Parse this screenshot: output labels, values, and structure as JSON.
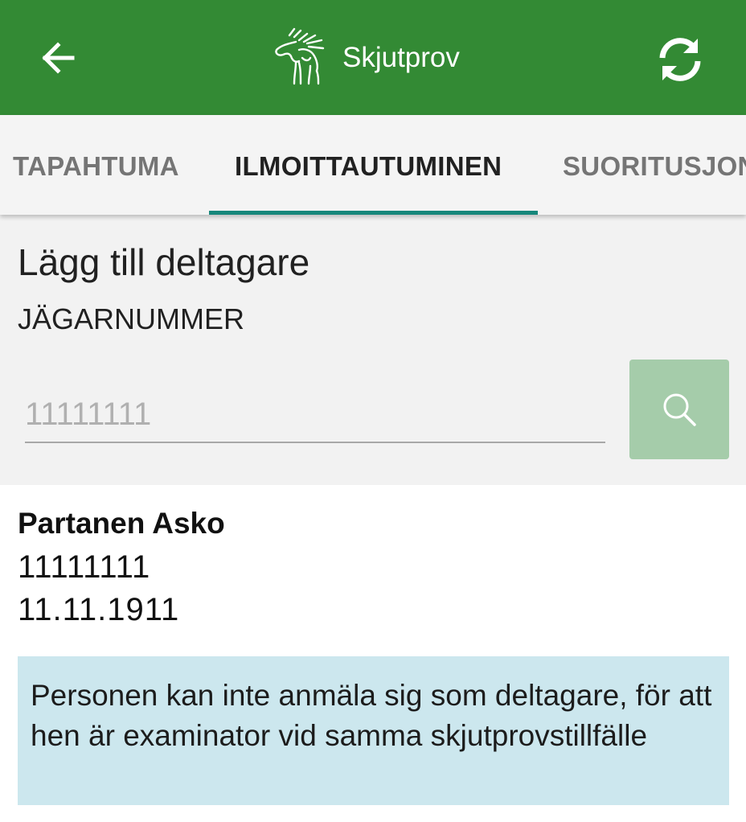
{
  "app_bar": {
    "title": "Skjutprov",
    "back_icon": "arrow-left-icon",
    "refresh_icon": "sync-icon",
    "logo_icon": "moose-logo-icon",
    "background_color": "#338a34"
  },
  "tabs": [
    {
      "label": "TAPAHTUMA",
      "active": false
    },
    {
      "label": "ILMOITTAUTUMINEN",
      "active": true
    },
    {
      "label": "SUORITUSJONO",
      "active": false
    }
  ],
  "tab_indicator_color": "#17877b",
  "form": {
    "title": "Lägg till deltagare",
    "field_label": "JÄGARNUMMER",
    "hunter_number_placeholder": "11111111",
    "hunter_number_value": "",
    "search_icon": "search-icon",
    "search_button_color": "#a5ccaa"
  },
  "result": {
    "name": "Partanen Asko",
    "hunter_number": "11111111",
    "birth_date": "11.11.1911"
  },
  "notice": {
    "text": "Personen kan inte anmäla sig som deltagare, för att hen är examinator vid samma skjutprovstillfälle",
    "background_color": "#cce7ee"
  }
}
